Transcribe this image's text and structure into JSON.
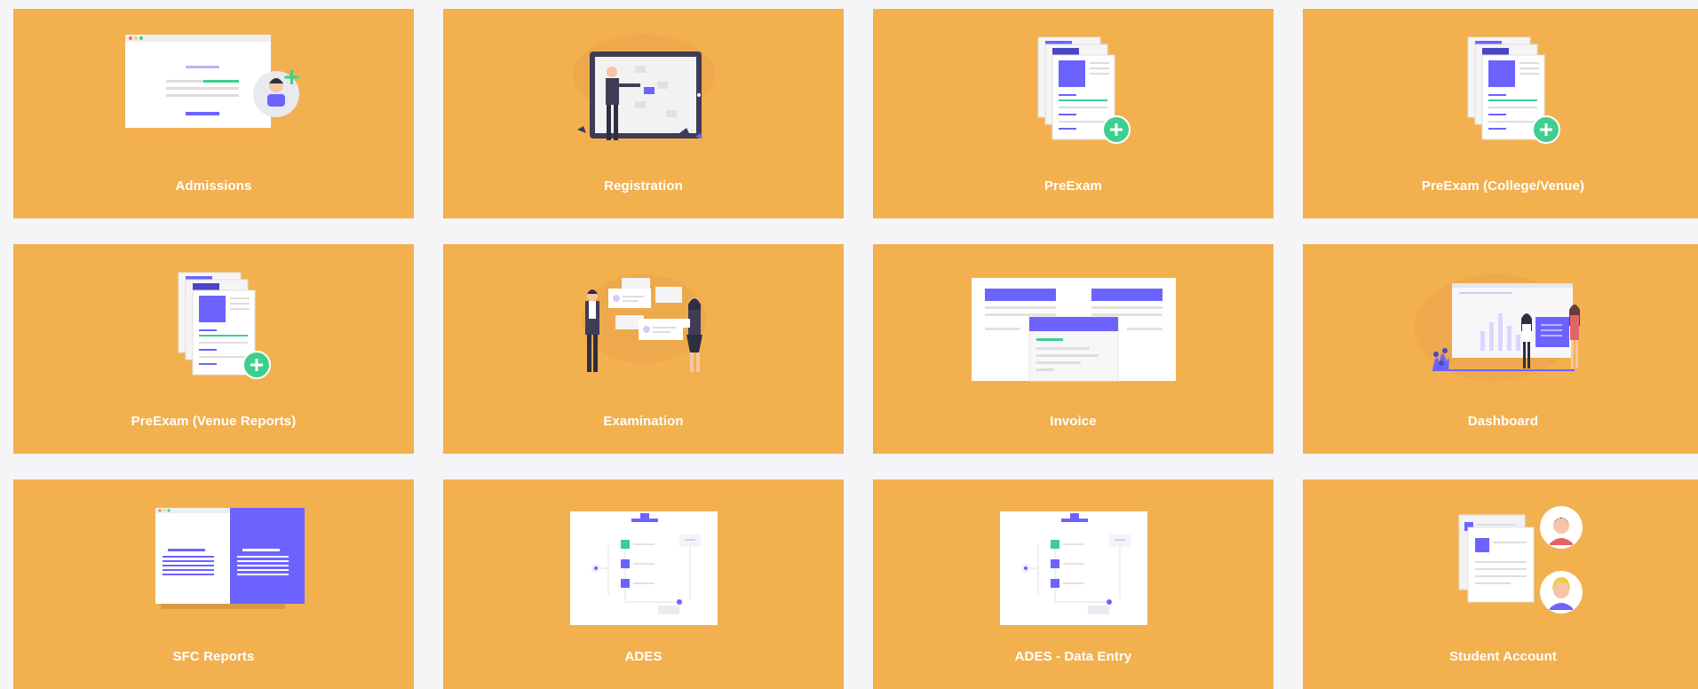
{
  "tiles": [
    {
      "label": "Admissions",
      "icon": "admissions-icon"
    },
    {
      "label": "Registration",
      "icon": "registration-icon"
    },
    {
      "label": "PreExam",
      "icon": "preexam-icon"
    },
    {
      "label": "PreExam (College/Venue)",
      "icon": "preexam-college-venue-icon"
    },
    {
      "label": "PreExam (Venue Reports)",
      "icon": "preexam-venue-reports-icon"
    },
    {
      "label": "Examination",
      "icon": "examination-icon"
    },
    {
      "label": "Invoice",
      "icon": "invoice-icon"
    },
    {
      "label": "Dashboard",
      "icon": "dashboard-icon"
    },
    {
      "label": "SFC Reports",
      "icon": "sfc-reports-icon"
    },
    {
      "label": "ADES",
      "icon": "ades-icon"
    },
    {
      "label": "ADES - Data Entry",
      "icon": "ades-data-entry-icon"
    },
    {
      "label": "Student Account",
      "icon": "student-account-icon"
    }
  ],
  "colors": {
    "tile": "#f2b04f",
    "accent": "#6c63ff",
    "green": "#3ecf8e",
    "background": "#f5f5f7"
  }
}
